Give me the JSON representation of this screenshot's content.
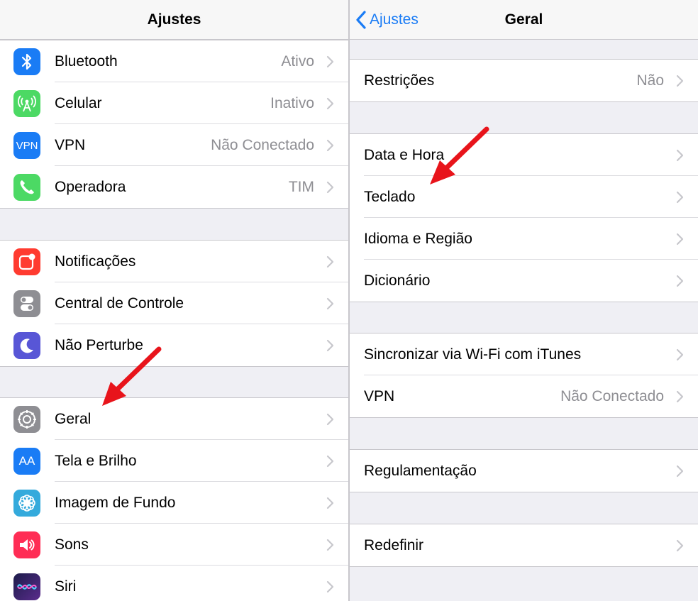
{
  "left": {
    "title": "Ajustes",
    "groups": [
      [
        {
          "label": "Bluetooth",
          "value": "Ativo",
          "icon": "bluetooth-icon",
          "color": "#1a7cf5"
        },
        {
          "label": "Celular",
          "value": "Inativo",
          "icon": "cellular-icon",
          "color": "#4cd964"
        },
        {
          "label": "VPN",
          "value": "Não Conectado",
          "icon": "vpn-icon",
          "icon_text": "VPN",
          "color": "#1a7cf5"
        },
        {
          "label": "Operadora",
          "value": "TIM",
          "icon": "phone-icon",
          "color": "#4cd964"
        }
      ],
      [
        {
          "label": "Notificações",
          "value": "",
          "icon": "notifications-icon",
          "color": "#ff3b30"
        },
        {
          "label": "Central de Controle",
          "value": "",
          "icon": "control-center-icon",
          "color": "#8e8e93"
        },
        {
          "label": "Não Perturbe",
          "value": "",
          "icon": "moon-icon",
          "color": "#5856d6"
        }
      ],
      [
        {
          "label": "Geral",
          "value": "",
          "icon": "gear-icon",
          "color": "#8e8e93"
        },
        {
          "label": "Tela e Brilho",
          "value": "",
          "icon": "display-brightness-icon",
          "icon_text": "AA",
          "color": "#1a7cf5"
        },
        {
          "label": "Imagem de Fundo",
          "value": "",
          "icon": "wallpaper-icon",
          "color": "#34aadc"
        },
        {
          "label": "Sons",
          "value": "",
          "icon": "speaker-icon",
          "color": "#ff2d55"
        },
        {
          "label": "Siri",
          "value": "",
          "icon": "siri-icon",
          "color": "#2b2b6b"
        }
      ]
    ]
  },
  "right": {
    "back_label": "Ajustes",
    "title": "Geral",
    "groups": [
      [
        {
          "label": "Restrições",
          "value": "Não"
        }
      ],
      [
        {
          "label": "Data e Hora",
          "value": ""
        },
        {
          "label": "Teclado",
          "value": ""
        },
        {
          "label": "Idioma e Região",
          "value": ""
        },
        {
          "label": "Dicionário",
          "value": ""
        }
      ],
      [
        {
          "label": "Sincronizar via Wi-Fi com iTunes",
          "value": ""
        },
        {
          "label": "VPN",
          "value": "Não Conectado"
        }
      ],
      [
        {
          "label": "Regulamentação",
          "value": ""
        }
      ],
      [
        {
          "label": "Redefinir",
          "value": ""
        }
      ]
    ]
  },
  "annotation_color": "#e8141b"
}
